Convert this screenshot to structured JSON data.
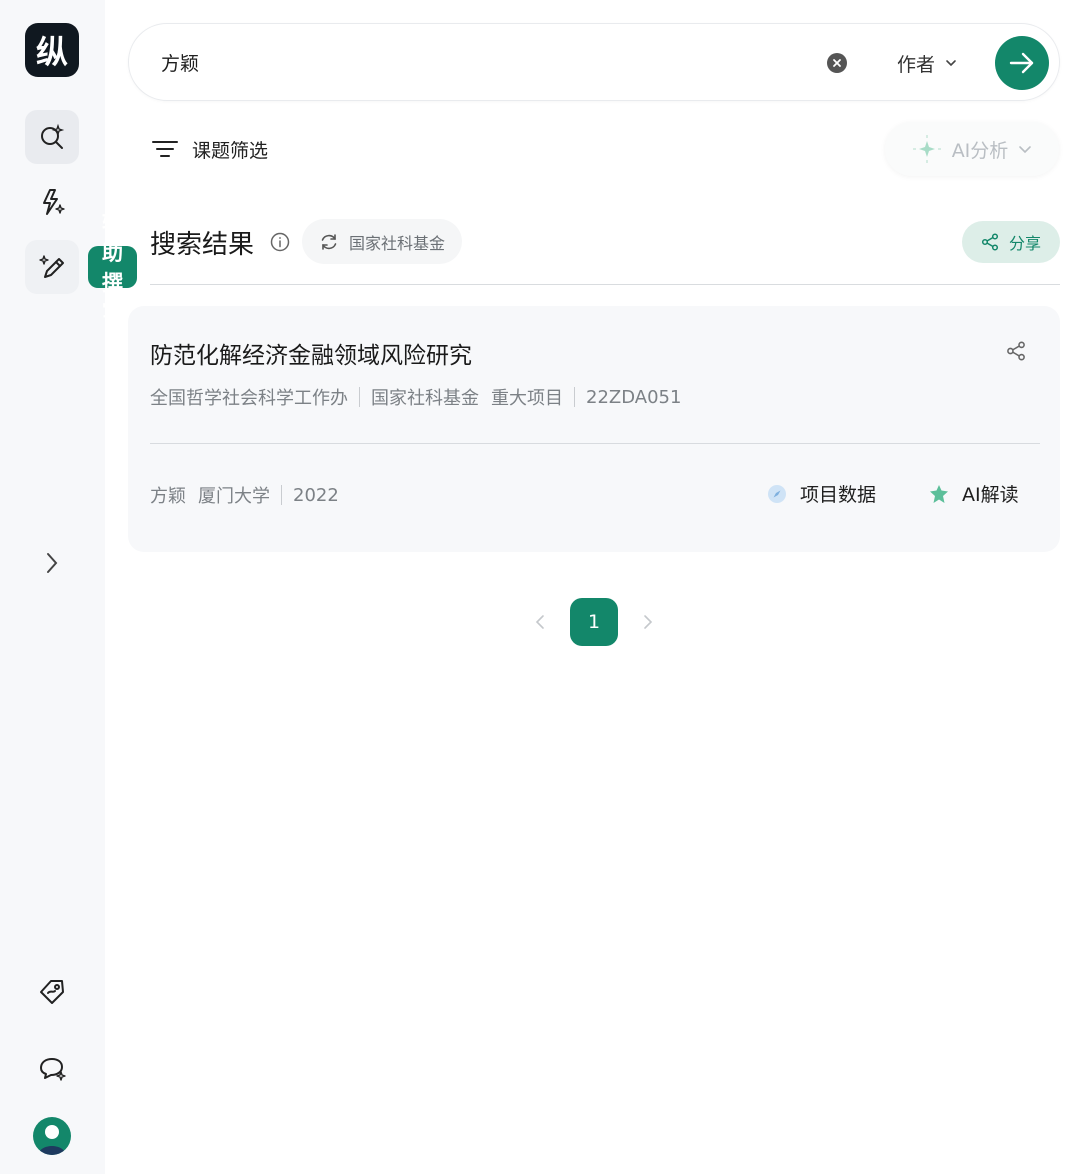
{
  "app": {
    "logo_text": "纵"
  },
  "sidebar": {
    "tooltip": "辅助撰写",
    "icons": [
      "search-sparkle-icon",
      "flash-sparkle-icon",
      "pen-sparkle-icon",
      "tag-icon",
      "chat-sparkle-icon",
      "user-avatar"
    ]
  },
  "search": {
    "query": "方颖",
    "field": "作者"
  },
  "toolbar": {
    "filter_label": "课题筛选",
    "ai_analyze_label": "AI分析"
  },
  "results": {
    "title": "搜索结果",
    "source_chip": "国家社科基金",
    "share_label": "分享"
  },
  "items": [
    {
      "title": "防范化解经济金融领域风险研究",
      "org": "全国哲学社会科学工作办",
      "fund": "国家社科基金",
      "category": "重大项目",
      "code": "22ZDA051",
      "author": "方颖",
      "institution": "厦门大学",
      "year": "2022",
      "project_data_label": "项目数据",
      "ai_read_label": "AI解读"
    }
  ],
  "pagination": {
    "current": "1"
  },
  "colors": {
    "accent": "#13876a",
    "sidebar_bg": "#f7f8fa",
    "card_bg": "#f7f8fa"
  }
}
